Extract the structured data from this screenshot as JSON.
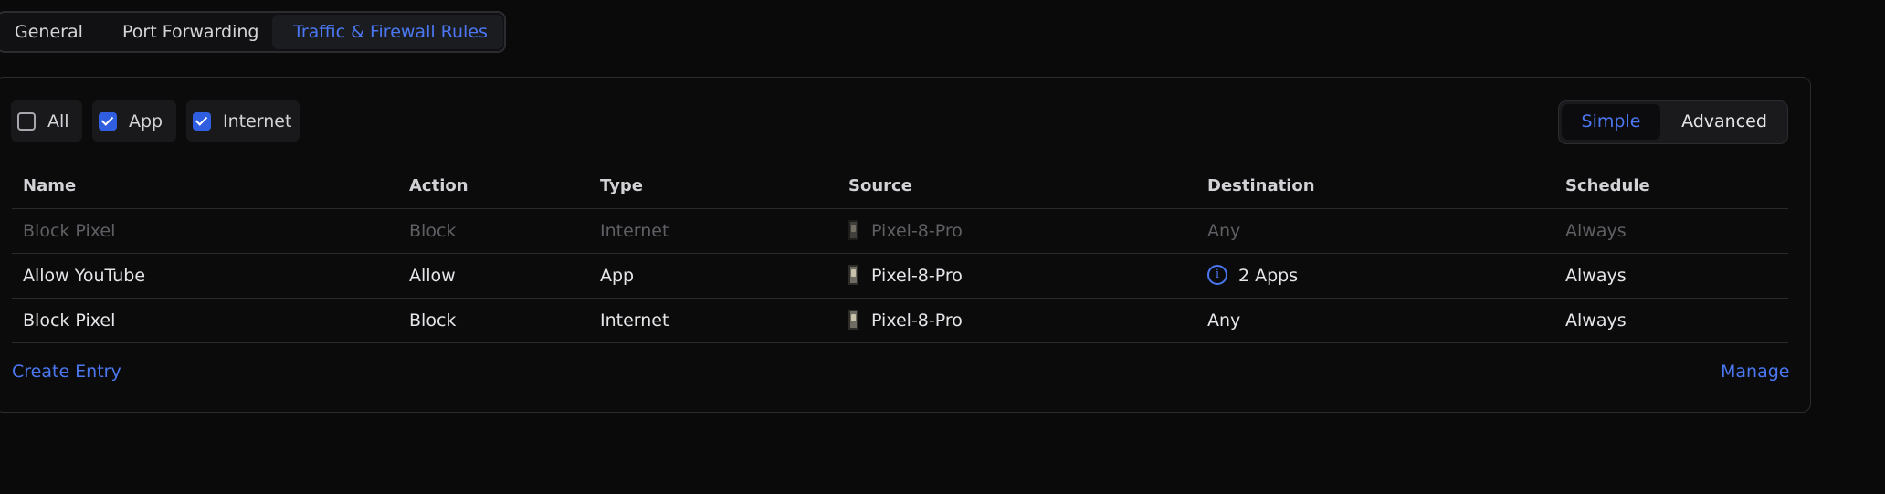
{
  "tabs": [
    {
      "label": "General"
    },
    {
      "label": "Port Forwarding"
    },
    {
      "label": "Traffic & Firewall Rules",
      "active": true
    }
  ],
  "filters": {
    "all": {
      "label": "All",
      "checked": false
    },
    "app": {
      "label": "App",
      "checked": true
    },
    "internet": {
      "label": "Internet",
      "checked": true
    }
  },
  "view_toggle": {
    "simple": "Simple",
    "advanced": "Advanced",
    "selected": "Simple"
  },
  "table": {
    "headers": [
      "Name",
      "Action",
      "Type",
      "Source",
      "Destination",
      "Schedule"
    ],
    "rows": [
      {
        "name": "Block Pixel",
        "action": "Block",
        "type": "Internet",
        "source": "Pixel-8-Pro",
        "destination": "Any",
        "schedule": "Always",
        "disabled": true
      },
      {
        "name": "Allow YouTube",
        "action": "Allow",
        "type": "App",
        "source": "Pixel-8-Pro",
        "destination": "2 Apps",
        "schedule": "Always",
        "disabled": false
      },
      {
        "name": "Block Pixel",
        "action": "Block",
        "type": "Internet",
        "source": "Pixel-8-Pro",
        "destination": "Any",
        "schedule": "Always",
        "disabled": false
      }
    ]
  },
  "footer": {
    "create": "Create Entry",
    "manage": "Manage"
  },
  "colors": {
    "accent": "#4b78f2",
    "background": "#0a0a0b",
    "checkbox_checked": "#2f5fe0"
  },
  "icons": {
    "device": "phone-device-icon",
    "info": "info-icon",
    "checked": "checkmark-icon"
  }
}
